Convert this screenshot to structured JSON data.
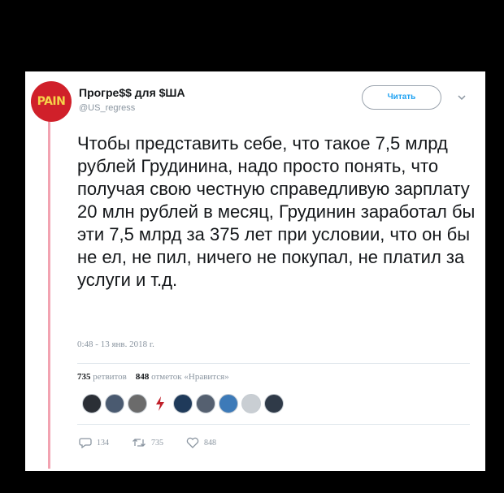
{
  "tweet": {
    "avatar_text": "PAIN",
    "display_name": "Прогре$$ для $ША",
    "handle": "@US_regress",
    "follow_label": "Читать",
    "text": "Чтобы представить себе, что такое 7,5 млрд рублей Грудинина, надо просто понять, что получая свою честную справедливую зарплату 20 млн рублей в месяц, Грудинин заработал бы эти 7,5 млрд за 375 лет при условии, что он бы не ел, не пил, ничего не покупал, не платил за услуги и т.д.",
    "timestamp": "0:48 - 13 янв. 2018 г.",
    "stats": {
      "retweets_count": "735",
      "retweets_label": "ретвитов",
      "likes_count": "848",
      "likes_label": "отметок «Нравится»"
    },
    "actions": {
      "reply_count": "134",
      "retweet_count": "735",
      "like_count": "848"
    },
    "colors": {
      "accent": "#1da1f2",
      "avatar_bg": "#d0202a",
      "avatar_text": "#f6d44a",
      "rail": "#f2a3b1"
    },
    "icons": {
      "reply": "reply-icon",
      "retweet": "retweet-icon",
      "like": "heart-icon",
      "more": "chevron-down-icon"
    }
  }
}
